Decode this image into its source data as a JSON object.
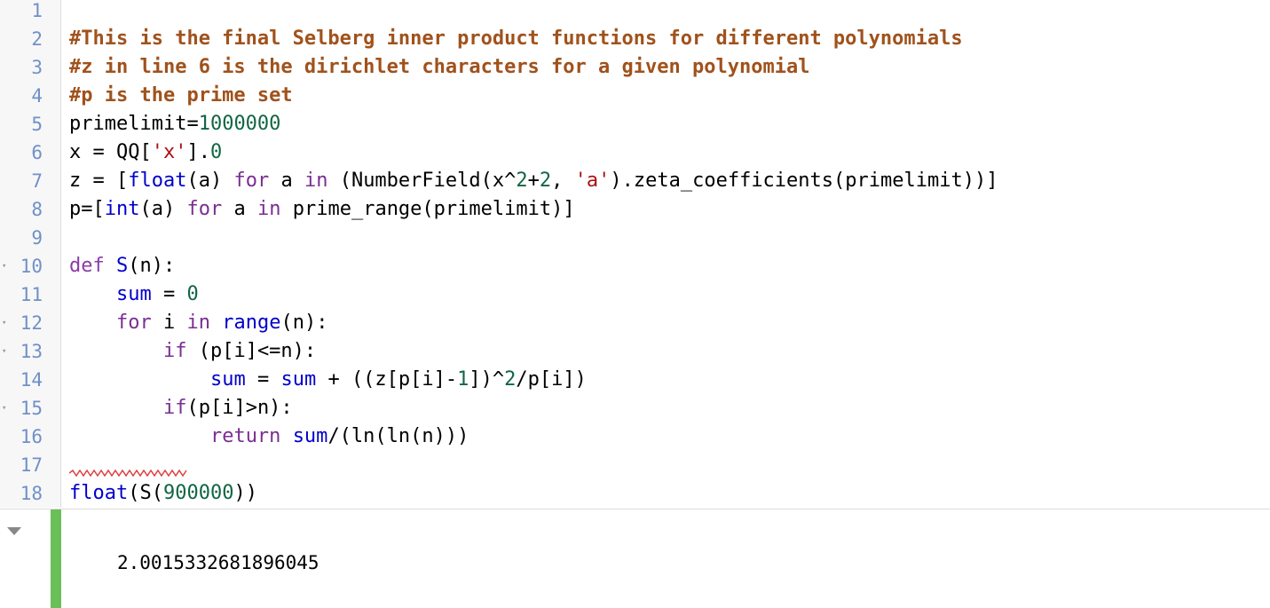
{
  "editor": {
    "line_numbers": [
      "1",
      "2",
      "3",
      "4",
      "5",
      "6",
      "7",
      "8",
      "9",
      "10",
      "11",
      "12",
      "13",
      "14",
      "15",
      "16",
      "17",
      "18"
    ],
    "lines": [
      [],
      [
        {
          "t": "#This is the final Selberg inner product functions for different polynomials",
          "c": "com"
        }
      ],
      [
        {
          "t": "#z in line 6 is the dirichlet characters for a given polynomial",
          "c": "com"
        }
      ],
      [
        {
          "t": "#p is the prime set",
          "c": "com"
        }
      ],
      [
        {
          "t": "primelimit="
        },
        {
          "t": "1000000",
          "c": "num"
        }
      ],
      [
        {
          "t": "x = QQ["
        },
        {
          "t": "'x'",
          "c": "str"
        },
        {
          "t": "]."
        },
        {
          "t": "0",
          "c": "num"
        }
      ],
      [
        {
          "t": "z = ["
        },
        {
          "t": "float",
          "c": "fn"
        },
        {
          "t": "(a) "
        },
        {
          "t": "for",
          "c": "kw"
        },
        {
          "t": " a "
        },
        {
          "t": "in",
          "c": "kw"
        },
        {
          "t": " (NumberField(x^"
        },
        {
          "t": "2",
          "c": "num"
        },
        {
          "t": "+"
        },
        {
          "t": "2",
          "c": "num"
        },
        {
          "t": ", "
        },
        {
          "t": "'a'",
          "c": "str"
        },
        {
          "t": ").zeta_coefficients(primelimit))]"
        }
      ],
      [
        {
          "t": "p=["
        },
        {
          "t": "int",
          "c": "fn"
        },
        {
          "t": "(a) "
        },
        {
          "t": "for",
          "c": "kw"
        },
        {
          "t": " a "
        },
        {
          "t": "in",
          "c": "kw"
        },
        {
          "t": " prime_range(primelimit)]"
        }
      ],
      [],
      [
        {
          "t": "def",
          "c": "kw2"
        },
        {
          "t": " "
        },
        {
          "t": "S",
          "c": "fn"
        },
        {
          "t": "(n):"
        }
      ],
      [
        {
          "t": "    "
        },
        {
          "t": "sum",
          "c": "fn"
        },
        {
          "t": " = "
        },
        {
          "t": "0",
          "c": "num"
        }
      ],
      [
        {
          "t": "    "
        },
        {
          "t": "for",
          "c": "kw"
        },
        {
          "t": " i "
        },
        {
          "t": "in",
          "c": "kw"
        },
        {
          "t": " "
        },
        {
          "t": "range",
          "c": "fn"
        },
        {
          "t": "(n):"
        }
      ],
      [
        {
          "t": "        "
        },
        {
          "t": "if",
          "c": "kw"
        },
        {
          "t": " (p[i]<=n):"
        }
      ],
      [
        {
          "t": "            "
        },
        {
          "t": "sum",
          "c": "fn"
        },
        {
          "t": " = "
        },
        {
          "t": "sum",
          "c": "fn"
        },
        {
          "t": " + ((z[p[i]-"
        },
        {
          "t": "1",
          "c": "num"
        },
        {
          "t": "])^"
        },
        {
          "t": "2",
          "c": "num"
        },
        {
          "t": "/p[i])"
        }
      ],
      [
        {
          "t": "        "
        },
        {
          "t": "if",
          "c": "kw"
        },
        {
          "t": "(p[i]>n):"
        }
      ],
      [
        {
          "t": "            "
        },
        {
          "t": "return",
          "c": "kw"
        },
        {
          "t": " "
        },
        {
          "t": "sum",
          "c": "fn"
        },
        {
          "t": "/(ln(ln(n)))"
        }
      ],
      [],
      [
        {
          "t": "float",
          "c": "fn"
        },
        {
          "t": "(S("
        },
        {
          "t": "900000",
          "c": "num"
        },
        {
          "t": "))"
        }
      ]
    ],
    "fold_lines": [
      10,
      12,
      13,
      15
    ]
  },
  "output": {
    "value": "2.0015332681896045"
  },
  "colors": {
    "comment": "#a0521c",
    "keyword": "#7a2e91",
    "builtin": "#0000cc",
    "number": "#116644",
    "string": "#aa1111",
    "gutter_number": "#7090c8",
    "output_bar": "#6bbf59"
  },
  "icons": {
    "fold_marker": "fold-arrow-icon",
    "collapse_output": "collapse-output-icon"
  }
}
